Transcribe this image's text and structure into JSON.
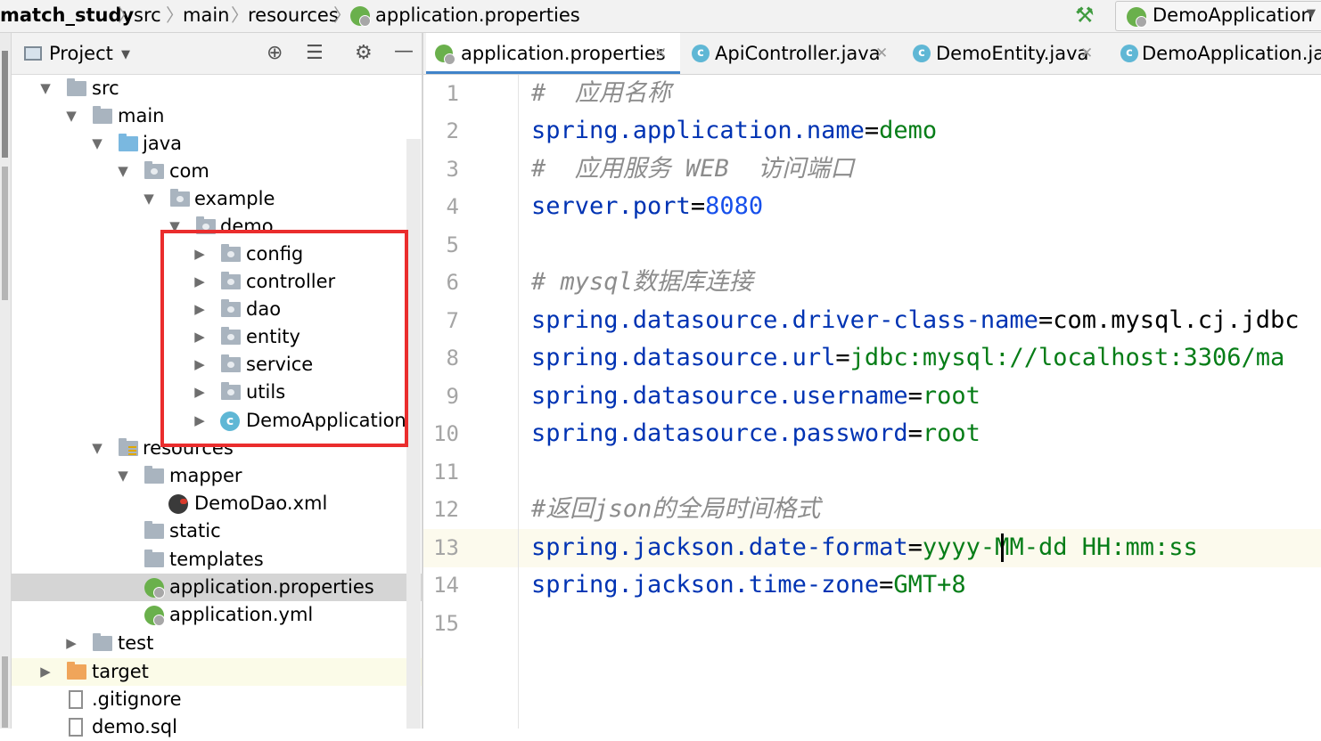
{
  "breadcrumb": {
    "items": [
      "match_study",
      "src",
      "main",
      "resources",
      "application.properties"
    ]
  },
  "run_config": {
    "name": "DemoApplication"
  },
  "project_panel": {
    "title": "Project",
    "tree": [
      {
        "label": "src",
        "expanded": true
      },
      {
        "label": "main",
        "expanded": true
      },
      {
        "label": "java",
        "expanded": true
      },
      {
        "label": "com",
        "expanded": true
      },
      {
        "label": "example",
        "expanded": true
      },
      {
        "label": "demo",
        "expanded": true
      },
      {
        "label": "config"
      },
      {
        "label": "controller"
      },
      {
        "label": "dao"
      },
      {
        "label": "entity"
      },
      {
        "label": "service"
      },
      {
        "label": "utils"
      },
      {
        "label": "DemoApplication"
      },
      {
        "label": "resources",
        "expanded": true
      },
      {
        "label": "mapper",
        "expanded": true
      },
      {
        "label": "DemoDao.xml"
      },
      {
        "label": "static"
      },
      {
        "label": "templates"
      },
      {
        "label": "application.properties",
        "selected": true
      },
      {
        "label": "application.yml"
      },
      {
        "label": "test"
      },
      {
        "label": "target"
      },
      {
        "label": ".gitignore"
      },
      {
        "label": "demo.sql"
      }
    ]
  },
  "tabs": [
    {
      "label": "application.properties",
      "active": true
    },
    {
      "label": "ApiController.java"
    },
    {
      "label": "DemoEntity.java"
    },
    {
      "label": "DemoApplication.java"
    }
  ],
  "editor": {
    "current_line": 13,
    "lines": [
      {
        "num": "1",
        "text": "#  应用名称"
      },
      {
        "num": "2",
        "key": "spring.application.name",
        "value": "demo"
      },
      {
        "num": "3",
        "text": "#  应用服务 WEB  访问端口"
      },
      {
        "num": "4",
        "key": "server.port",
        "value": "8080"
      },
      {
        "num": "5"
      },
      {
        "num": "6",
        "text": "# mysql数据库连接"
      },
      {
        "num": "7",
        "key": "spring.datasource.driver-class-name",
        "value": "com.mysql.cj.jdbc"
      },
      {
        "num": "8",
        "key": "spring.datasource.url",
        "value": "jdbc:mysql://localhost:3306/ma"
      },
      {
        "num": "9",
        "key": "spring.datasource.username",
        "value": "root"
      },
      {
        "num": "10",
        "key": "spring.datasource.password",
        "value": "root"
      },
      {
        "num": "11"
      },
      {
        "num": "12",
        "text": "#返回json的全局时间格式"
      },
      {
        "num": "13",
        "key": "spring.jackson.date-format",
        "value": "yyyy-MM-dd HH:mm:ss"
      },
      {
        "num": "14",
        "key": "spring.jackson.time-zone",
        "value": "GMT+8"
      },
      {
        "num": "15"
      }
    ]
  },
  "colors": {
    "key": "#0033b3",
    "string_value": "#067d17",
    "number_value": "#1750eb",
    "comment": "#8c8c8c",
    "highlight_box": "#ea2d2d",
    "caret_line": "#fcfaed"
  }
}
